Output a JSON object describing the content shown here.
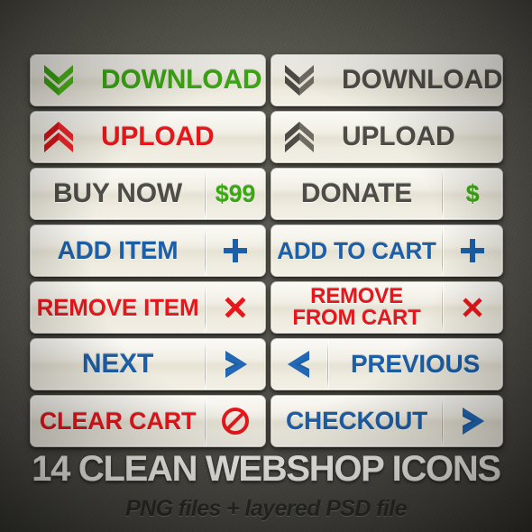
{
  "meta": {
    "background_color": "#514f47",
    "button_face_color": "#efece1"
  },
  "palette": {
    "green": "#3aa811",
    "red": "#e8161b",
    "blue": "#1c5fa8",
    "gray": "#4e4c47",
    "gray_light": "#6d6a62",
    "title_white": "#f2f0ea"
  },
  "buttons": [
    {
      "id": "download-green",
      "label": "DOWNLOAD",
      "label_color": "green",
      "icon": "double-chevron-down-icon",
      "icon_color": "green",
      "icon_side": "left",
      "column": "left",
      "row": 1
    },
    {
      "id": "download-gray",
      "label": "DOWNLOAD",
      "label_color": "gray",
      "icon": "double-chevron-down-icon",
      "icon_color": "gray",
      "icon_side": "left",
      "column": "right",
      "row": 1
    },
    {
      "id": "upload-red",
      "label": "UPLOAD",
      "label_color": "red",
      "icon": "double-chevron-up-icon",
      "icon_color": "red",
      "icon_side": "left",
      "column": "left",
      "row": 2
    },
    {
      "id": "upload-gray",
      "label": "UPLOAD",
      "label_color": "gray",
      "icon": "double-chevron-up-icon",
      "icon_color": "gray",
      "icon_side": "left",
      "column": "right",
      "row": 2
    },
    {
      "id": "buy-now",
      "label": "BUY NOW",
      "label_color": "gray",
      "badge": "$99",
      "badge_color": "green",
      "icon_side": "right",
      "column": "left",
      "row": 3
    },
    {
      "id": "donate",
      "label": "DONATE",
      "label_color": "gray",
      "badge": "$",
      "badge_color": "green",
      "icon_side": "right",
      "column": "right",
      "row": 3
    },
    {
      "id": "add-item",
      "label": "ADD ITEM",
      "label_color": "blue",
      "icon": "plus-icon",
      "icon_color": "blue",
      "icon_side": "right",
      "column": "left",
      "row": 4
    },
    {
      "id": "add-to-cart",
      "label": "ADD TO CART",
      "label_color": "blue",
      "icon": "plus-icon",
      "icon_color": "blue",
      "icon_side": "right",
      "column": "right",
      "row": 4
    },
    {
      "id": "remove-item",
      "label": "REMOVE ITEM",
      "label_color": "red",
      "icon": "cross-icon",
      "icon_color": "red",
      "icon_side": "right",
      "column": "left",
      "row": 5
    },
    {
      "id": "remove-from-cart",
      "label": "REMOVE FROM CART",
      "label_line1": "REMOVE",
      "label_line2": "FROM CART",
      "label_color": "red",
      "icon": "cross-icon",
      "icon_color": "red",
      "icon_side": "right",
      "column": "right",
      "row": 5
    },
    {
      "id": "next",
      "label": "NEXT",
      "label_color": "blue",
      "icon": "chevron-right-icon",
      "icon_color": "blue",
      "icon_side": "right",
      "column": "left",
      "row": 6
    },
    {
      "id": "previous",
      "label": "PREVIOUS",
      "label_color": "blue",
      "icon": "chevron-left-icon",
      "icon_color": "blue",
      "icon_side": "left",
      "column": "right",
      "row": 6
    },
    {
      "id": "clear-cart",
      "label": "CLEAR CART",
      "label_color": "red",
      "icon": "prohibition-icon",
      "icon_color": "red",
      "icon_side": "right",
      "column": "left",
      "row": 7
    },
    {
      "id": "checkout",
      "label": "CHECKOUT",
      "label_color": "blue",
      "icon": "chevron-right-icon",
      "icon_color": "blue",
      "icon_side": "right",
      "column": "right",
      "row": 7
    }
  ],
  "footer": {
    "title": "14 CLEAN WEBSHOP ICONS",
    "subtitle": "PNG files + layered PSD file"
  }
}
